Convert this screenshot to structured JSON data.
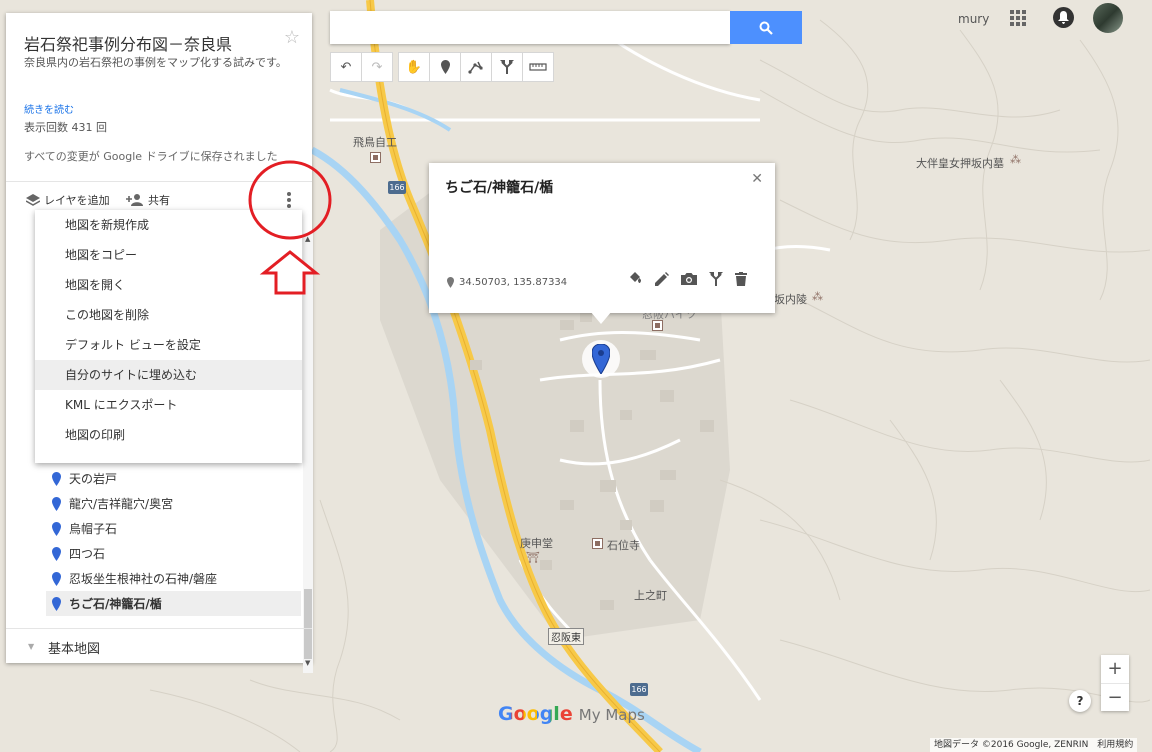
{
  "panel": {
    "title": "岩石祭祀事例分布図－奈良県",
    "description": "奈良県内の岩石祭祀の事例をマップ化する試みです。",
    "read_more": "続きを読む",
    "views": "表示回数 431 回",
    "saved": "すべての変更が Google ドライブに保存されました",
    "add_layer": "レイヤを追加",
    "share": "共有",
    "base_map": "基本地図"
  },
  "menu": {
    "items": [
      "地図を新規作成",
      "地図をコピー",
      "地図を開く",
      "この地図を削除",
      "デフォルト ビューを設定",
      "自分のサイトに埋め込む",
      "KML にエクスポート",
      "地図の印刷"
    ],
    "highlighted_index": 5
  },
  "layer_items": [
    "天の岩戸",
    "龍穴/吉祥龍穴/奥宮",
    "烏帽子石",
    "四つ石",
    "忍坂坐生根神社の石神/磐座",
    "ちご石/神籠石/楯"
  ],
  "header": {
    "user": "mury"
  },
  "info": {
    "title": "ちご石/神籠石/楯",
    "coords": "34.50703, 135.87334"
  },
  "map_labels": {
    "asuka_jiko": "飛鳥自工",
    "road_166_a": "166",
    "road_166_b": "166",
    "otomo_tomb": "大伴皇女押坂内墓",
    "sakauchi_ryo": "坂内陵",
    "koshindo": "庚申堂",
    "sekiiji": "石位寺",
    "kaminocho": "上之町",
    "oshisaka_higashi": "忍阪東",
    "oshisaka_partial": "忍阪ハイツ"
  },
  "logo": {
    "google": "Google",
    "mymaps": "My Maps"
  },
  "attribution": "地図データ ©2016 Google, ZENRIN　利用規約",
  "colors": {
    "search_button": "#4d90fe",
    "pin_blue": "#3367d6",
    "road_yellow": "#f7c948",
    "river_blue": "#a8d4f4",
    "annotation_red": "#e31e24"
  }
}
